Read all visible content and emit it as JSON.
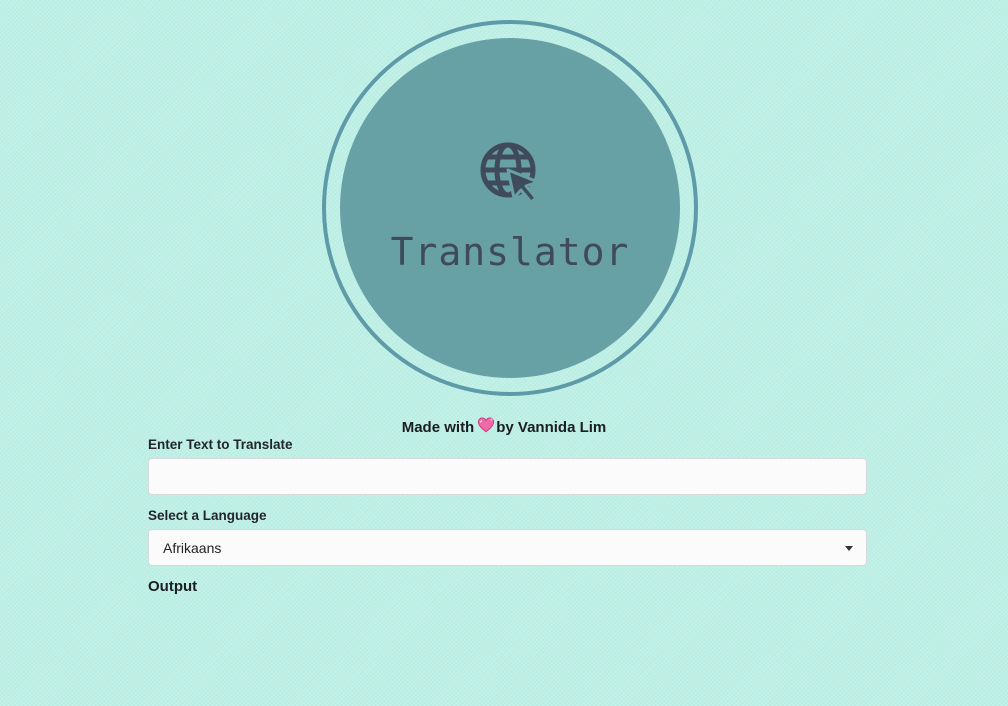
{
  "logo": {
    "title": "Translator",
    "icon": "globe-cursor-icon"
  },
  "credit": {
    "prefix": "Made with",
    "icon": "sparkling-heart-icon",
    "suffix": "by Vannida Lim"
  },
  "form": {
    "text_label": "Enter Text to Translate",
    "text_value": "",
    "text_placeholder": "",
    "language_label": "Select a Language",
    "language_selected": "Afrikaans",
    "output_label": "Output"
  },
  "colors": {
    "background": "#bff0e6",
    "circle_fill": "#67a1a5",
    "circle_ring": "#5e9aa8",
    "icon_text": "#3f4a5a"
  }
}
